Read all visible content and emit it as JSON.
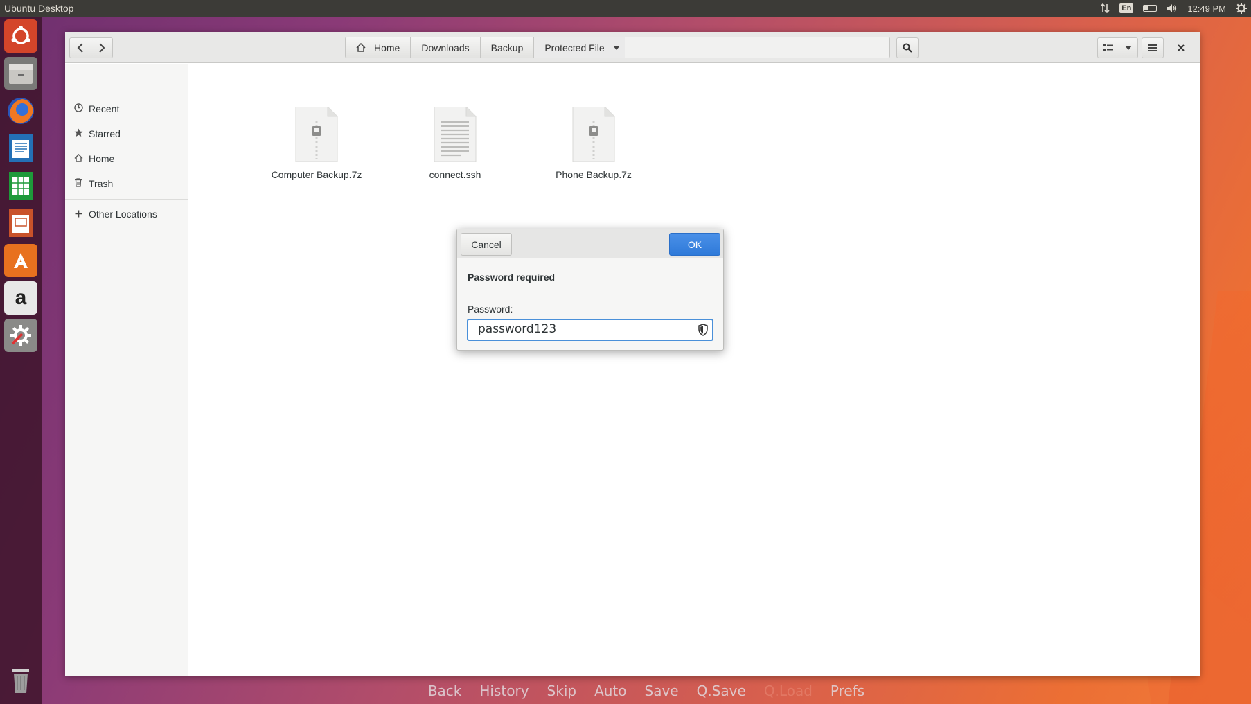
{
  "top_panel": {
    "title": "Ubuntu Desktop",
    "keyboard": "En",
    "time": "12:49 PM"
  },
  "launcher": {
    "items": [
      {
        "name": "ubuntu-dash-icon"
      },
      {
        "name": "files-icon"
      },
      {
        "name": "firefox-icon"
      },
      {
        "name": "writer-icon"
      },
      {
        "name": "calc-icon"
      },
      {
        "name": "impress-icon"
      },
      {
        "name": "software-center-icon"
      },
      {
        "name": "amazon-icon",
        "glyph": "a"
      },
      {
        "name": "system-settings-icon"
      },
      {
        "name": "trash-icon"
      }
    ]
  },
  "window": {
    "breadcrumbs": [
      "Home",
      "Downloads",
      "Backup",
      "Protected File"
    ],
    "sidebar": {
      "items": [
        {
          "label": "Recent",
          "icon": "clock-icon"
        },
        {
          "label": "Starred",
          "icon": "star-icon"
        },
        {
          "label": "Home",
          "icon": "home-icon"
        },
        {
          "label": "Trash",
          "icon": "trash-icon"
        }
      ],
      "other_locations": "Other Locations"
    },
    "files": [
      {
        "name": "Computer Backup.7z",
        "type": "archive"
      },
      {
        "name": "connect.ssh",
        "type": "text"
      },
      {
        "name": "Phone Backup.7z",
        "type": "archive"
      }
    ]
  },
  "dialog": {
    "cancel_label": "Cancel",
    "ok_label": "OK",
    "title": "Password required",
    "field_label": "Password:",
    "password_value": "password123"
  },
  "bottom_menu": {
    "items": [
      "Back",
      "History",
      "Skip",
      "Auto",
      "Save",
      "Q.Save",
      "Q.Load",
      "Prefs"
    ]
  },
  "colors": {
    "accent": "#4a90d9",
    "ok_button": "#3584e4",
    "top_panel": "#3c3b37"
  }
}
